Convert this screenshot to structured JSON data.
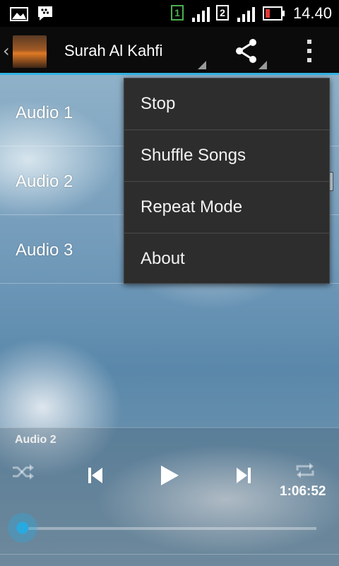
{
  "status_bar": {
    "time": "14.40",
    "sim1_label": "1",
    "sim2_label": "2",
    "icons": [
      "gallery-icon",
      "bbm-icon",
      "sim1-icon",
      "signal1-icon",
      "sim2-icon",
      "signal2-icon",
      "battery-icon"
    ]
  },
  "action_bar": {
    "title": "Surah Al Kahfi",
    "icons": [
      "back-chevron-icon",
      "app-logo",
      "share-icon",
      "overflow-menu-icon"
    ]
  },
  "playlist": {
    "items": [
      {
        "label": "Audio 1"
      },
      {
        "label": "Audio 2"
      },
      {
        "label": "Audio 3"
      }
    ]
  },
  "overflow_menu": {
    "items": [
      {
        "label": "Stop"
      },
      {
        "label": "Shuffle Songs"
      },
      {
        "label": "Repeat Mode"
      },
      {
        "label": "About"
      }
    ]
  },
  "player": {
    "now_playing": "Audio 2",
    "elapsed": "1:06:52",
    "progress": 0.0,
    "icons": [
      "shuffle-icon",
      "previous-icon",
      "play-icon",
      "next-icon",
      "repeat-icon"
    ]
  },
  "colors": {
    "accent": "#33b5e5",
    "menu_bg": "#2d2d2d",
    "seek_thumb": "#29a9e0",
    "battery_low": "#e53935",
    "sim_green": "#4caf50"
  }
}
